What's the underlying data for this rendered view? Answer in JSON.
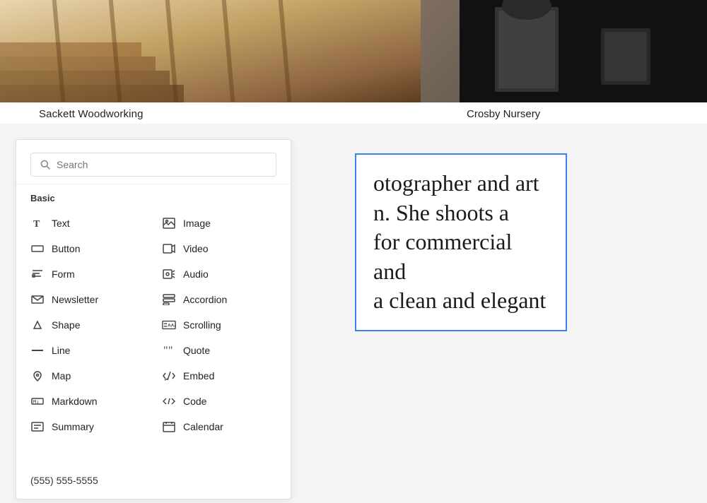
{
  "top": {
    "left": {
      "caption": "Sackett Woodworking"
    },
    "right": {
      "caption": "Crosby Nursery"
    }
  },
  "search": {
    "placeholder": "Search",
    "label": "Search"
  },
  "panel": {
    "section_basic": "Basic",
    "items": [
      {
        "id": "text",
        "label": "Text",
        "icon": "T",
        "col": 1
      },
      {
        "id": "image",
        "label": "Image",
        "icon": "img",
        "col": 2
      },
      {
        "id": "button",
        "label": "Button",
        "icon": "btn",
        "col": 1
      },
      {
        "id": "video",
        "label": "Video",
        "icon": "vid",
        "col": 2
      },
      {
        "id": "form",
        "label": "Form",
        "icon": "form",
        "col": 1
      },
      {
        "id": "audio",
        "label": "Audio",
        "icon": "audio",
        "col": 2
      },
      {
        "id": "newsletter",
        "label": "Newsletter",
        "icon": "mail",
        "col": 1
      },
      {
        "id": "accordion",
        "label": "Accordion",
        "icon": "acc",
        "col": 2
      },
      {
        "id": "shape",
        "label": "Shape",
        "icon": "shape",
        "col": 1
      },
      {
        "id": "scrolling",
        "label": "Scrolling",
        "icon": "scroll",
        "col": 2
      },
      {
        "id": "line",
        "label": "Line",
        "icon": "line",
        "col": 1
      },
      {
        "id": "quote",
        "label": "Quote",
        "icon": "quote",
        "col": 2
      },
      {
        "id": "map",
        "label": "Map",
        "icon": "map",
        "col": 1
      },
      {
        "id": "embed",
        "label": "Embed",
        "icon": "embed",
        "col": 2
      },
      {
        "id": "markdown",
        "label": "Markdown",
        "icon": "md",
        "col": 1
      },
      {
        "id": "code",
        "label": "Code",
        "icon": "code",
        "col": 2
      },
      {
        "id": "summary",
        "label": "Summary",
        "icon": "sum",
        "col": 1
      },
      {
        "id": "calendar",
        "label": "Calendar",
        "icon": "cal",
        "col": 2
      }
    ]
  },
  "content": {
    "text": "otographer and art\nn. She shoots a\nfor commercial and\na clean and elegant"
  },
  "footer": {
    "phone": "(555) 555-5555"
  }
}
